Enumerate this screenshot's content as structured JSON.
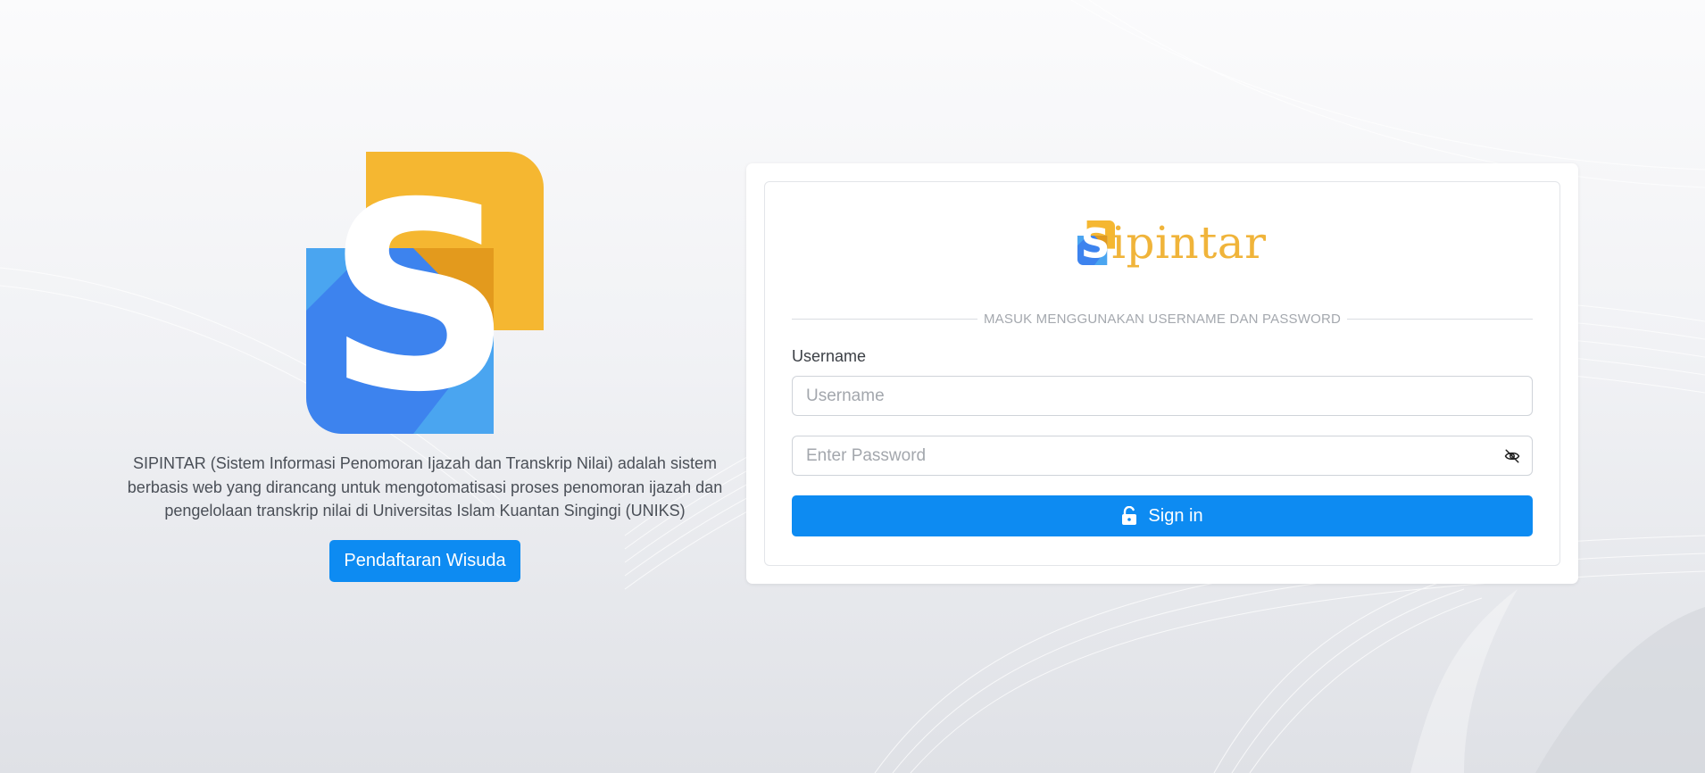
{
  "app": {
    "brand_name": "ipintar",
    "brand_initial": "S",
    "description": "SIPINTAR (Sistem Informasi Penomoran Ijazah dan Transkrip Nilai) adalah sistem berbasis web yang dirancang untuk mengotomatisasi proses penomoran ijazah dan pengelolaan transkrip nilai di Universitas Islam Kuantan Singingi (UNIKS)",
    "register_button": "Pendaftaran Wisuda"
  },
  "login": {
    "divider_text": "MASUK MENGGUNAKAN USERNAME DAN PASSWORD",
    "username_label": "Username",
    "username_placeholder": "Username",
    "username_value": "",
    "password_placeholder": "Enter Password",
    "password_value": "",
    "signin_label": "Sign in"
  },
  "icons": {
    "logo": "sipintar-logo-icon",
    "password_toggle": "eye-slash-icon",
    "signin": "unlock-icon"
  },
  "colors": {
    "primary": "#0d8bf2",
    "brand_yellow": "#f5b731",
    "brand_blue": "#3d83ee",
    "brand_light_blue": "#4aa5f0"
  }
}
